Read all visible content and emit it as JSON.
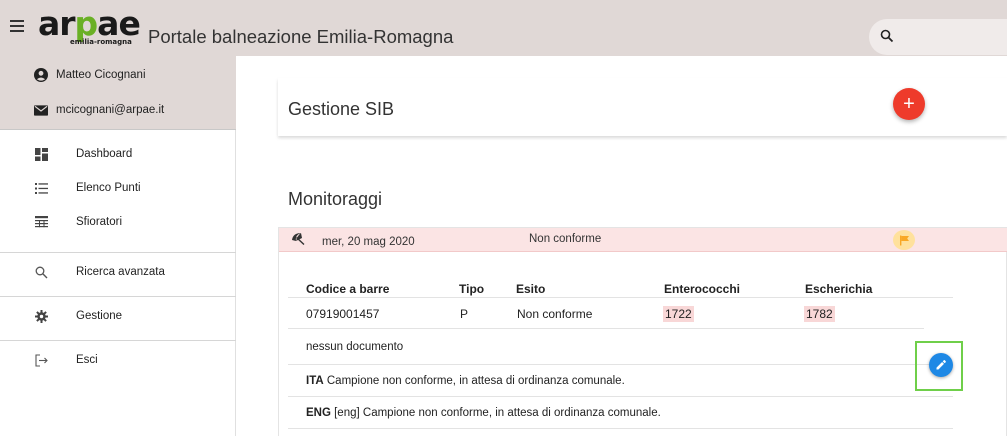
{
  "app": {
    "title": "Portale balneazione Emilia-Romagna",
    "logo_word": "arpae",
    "logo_sub": "emilia-romagna",
    "brand_green": "#6ab025"
  },
  "user": {
    "name": "Matteo Cicognani",
    "email": "mcicognani@arpae.it"
  },
  "sidebar": {
    "items": [
      {
        "label": "Dashboard",
        "icon": "dashboard-icon"
      },
      {
        "label": "Elenco Punti",
        "icon": "list-icon"
      },
      {
        "label": "Sfioratori",
        "icon": "table-icon"
      },
      {
        "label": "Ricerca avanzata",
        "icon": "search-icon"
      },
      {
        "label": "Gestione",
        "icon": "gear-icon"
      },
      {
        "label": "Esci",
        "icon": "exit-icon"
      }
    ]
  },
  "main": {
    "page_title": "Gestione SIB",
    "add_label": "+",
    "section_title": "Monitoraggi",
    "monitoring": {
      "date": "mer, 20 mag 2020",
      "status": "Non conforme",
      "columns": [
        "Codice a barre",
        "Tipo",
        "Esito",
        "Enterococchi",
        "Escherichia"
      ],
      "row": [
        "07919001457",
        "P",
        "Non conforme",
        "1722",
        "1782"
      ],
      "documents": "nessun documento",
      "messages": [
        {
          "lang": "ITA",
          "text": " Campione non conforme, in attesa di ordinanza comunale."
        },
        {
          "lang": "ENG",
          "text": " [eng] Campione non conforme, in attesa di ordinanza comunale."
        }
      ]
    }
  },
  "colors": {
    "header_bg": "#e0d8d6",
    "alert_bg": "#fbe4e4",
    "add_button": "#ee3b2b",
    "edit_button": "#1e88e5",
    "flag": "#f9a825",
    "highlight_frame": "#6fcf4a"
  }
}
